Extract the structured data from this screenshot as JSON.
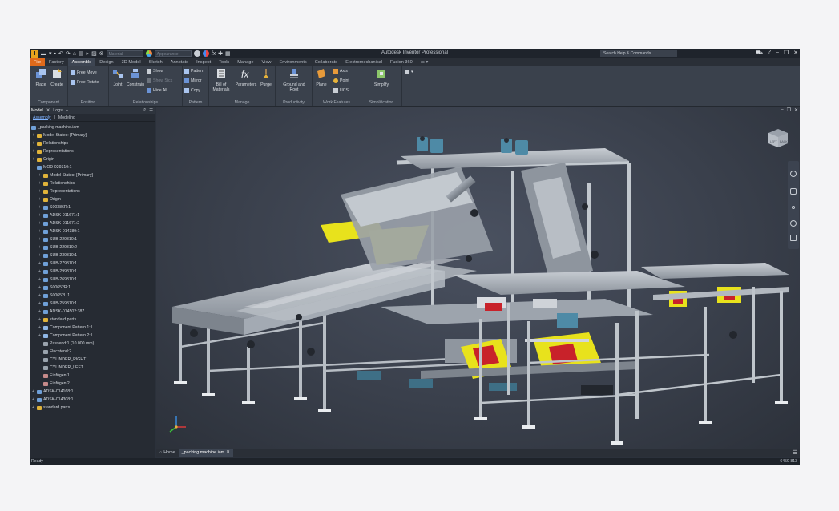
{
  "app_title": "Autodesk Inventor Professional",
  "qat": {
    "material": "Material",
    "appearance": "Appearance"
  },
  "search_placeholder": "Search Help & Commands...",
  "tabs": [
    "File",
    "Factory",
    "Assemble",
    "Design",
    "3D Model",
    "Sketch",
    "Annotate",
    "Inspect",
    "Tools",
    "Manage",
    "View",
    "Environments",
    "Collaborate",
    "Electromechanical",
    "Fusion 360"
  ],
  "active_tab": "Assemble",
  "ribbon": {
    "place": "Place",
    "create": "Create",
    "free_move": "Free Move",
    "free_rotate": "Free Rotate",
    "joint": "Joint",
    "constrain": "Constrain",
    "show": "Show",
    "show_sick": "Show Sick",
    "hide_all": "Hide All",
    "pattern": "Pattern",
    "mirror": "Mirror",
    "copy": "Copy",
    "bom_1": "Bill of",
    "bom_2": "Materials",
    "parameters": "Parameters",
    "purge": "Purge",
    "ground_1": "Ground and",
    "ground_2": "Root",
    "plane": "Plane",
    "axis": "Axis",
    "point": "Point",
    "ucs": "UCS",
    "simplify": "Simplify",
    "panel_component": "Component",
    "panel_position": "Position",
    "panel_relationships": "Relationships",
    "panel_pattern": "Pattern",
    "panel_manage": "Manage",
    "panel_productivity": "Productivity",
    "panel_workfeatures": "Work Features",
    "panel_simplification": "Simplification"
  },
  "browser": {
    "tab_model": "Model",
    "tab_logs": "Logs",
    "sub_assembly": "Assembly",
    "sub_modeling": "Modeling",
    "root": "_packing machine.iam",
    "nodes": [
      {
        "label": "Model States: [Primary]",
        "indent": 1,
        "exp": "+",
        "color": "#e0b33a"
      },
      {
        "label": "Relationships",
        "indent": 1,
        "exp": "+",
        "color": "#e0b33a"
      },
      {
        "label": "Representations",
        "indent": 1,
        "exp": "+",
        "color": "#e0b33a"
      },
      {
        "label": "Origin",
        "indent": 1,
        "exp": "+",
        "color": "#e0b33a"
      },
      {
        "label": "MOD-029310:1",
        "indent": 1,
        "exp": "−",
        "color": "#6fa0d8"
      },
      {
        "label": "Model States: [Primary]",
        "indent": 2,
        "exp": "+",
        "color": "#e0b33a"
      },
      {
        "label": "Relationships",
        "indent": 2,
        "exp": "+",
        "color": "#e0b33a"
      },
      {
        "label": "Representations",
        "indent": 2,
        "exp": "+",
        "color": "#e0b33a"
      },
      {
        "label": "Origin",
        "indent": 2,
        "exp": "+",
        "color": "#e0b33a"
      },
      {
        "label": "S00386R:1",
        "indent": 2,
        "exp": "+",
        "color": "#6fa0d8"
      },
      {
        "label": "ADSK-011671:1",
        "indent": 2,
        "exp": "+",
        "color": "#6fa0d8"
      },
      {
        "label": "ADSK-011671:2",
        "indent": 2,
        "exp": "+",
        "color": "#6fa0d8"
      },
      {
        "label": "ADSK-014389:1",
        "indent": 2,
        "exp": "+",
        "color": "#6fa0d8"
      },
      {
        "label": "SUB-229310:1",
        "indent": 2,
        "exp": "+",
        "color": "#6fa0d8"
      },
      {
        "label": "SUB-229310:2",
        "indent": 2,
        "exp": "+",
        "color": "#6fa0d8"
      },
      {
        "label": "SUB-239310:1",
        "indent": 2,
        "exp": "+",
        "color": "#6fa0d8"
      },
      {
        "label": "SUB-279310:1",
        "indent": 2,
        "exp": "+",
        "color": "#6fa0d8"
      },
      {
        "label": "SUB-299310:1",
        "indent": 2,
        "exp": "+",
        "color": "#6fa0d8"
      },
      {
        "label": "SUB-269310:1",
        "indent": 2,
        "exp": "+",
        "color": "#6fa0d8"
      },
      {
        "label": "S00652R:1",
        "indent": 2,
        "exp": "+",
        "color": "#6fa0d8"
      },
      {
        "label": "S00652L:1",
        "indent": 2,
        "exp": "+",
        "color": "#6fa0d8"
      },
      {
        "label": "SUB-259310:1",
        "indent": 2,
        "exp": "+",
        "color": "#6fa0d8"
      },
      {
        "label": "ADSK-014502:387",
        "indent": 2,
        "exp": "+",
        "color": "#6fa0d8"
      },
      {
        "label": "standard parts",
        "indent": 2,
        "exp": "+",
        "color": "#e0b33a"
      },
      {
        "label": "Component Pattern 1:1",
        "indent": 2,
        "exp": "+",
        "color": "#8fb7e6"
      },
      {
        "label": "Component Pattern 2:1",
        "indent": 2,
        "exp": "+",
        "color": "#8fb7e6"
      },
      {
        "label": "Passend:1 (10.000 mm)",
        "indent": 2,
        "exp": "",
        "color": "#9aa3ad"
      },
      {
        "label": "Fluchtend:2",
        "indent": 2,
        "exp": "",
        "color": "#9aa3ad"
      },
      {
        "label": "CYLINDER_RIGHT",
        "indent": 2,
        "exp": "",
        "color": "#9aa3ad"
      },
      {
        "label": "CYLINDER_LEFT",
        "indent": 2,
        "exp": "",
        "color": "#9aa3ad"
      },
      {
        "label": "Einfügen:1",
        "indent": 2,
        "exp": "",
        "color": "#c58a8a"
      },
      {
        "label": "Einfügen:2",
        "indent": 2,
        "exp": "",
        "color": "#c58a8a"
      },
      {
        "label": "ADSK-014168:1",
        "indent": 1,
        "exp": "+",
        "color": "#6fa0d8"
      },
      {
        "label": "ADSK-014308:1",
        "indent": 1,
        "exp": "+",
        "color": "#6fa0d8"
      },
      {
        "label": "standard parts",
        "indent": 1,
        "exp": "+",
        "color": "#e0b33a"
      }
    ]
  },
  "doc_tabs": {
    "home": "Home",
    "doc": "_packing machine.iam"
  },
  "viewcube": {
    "left": "LEFT",
    "back": "BACK"
  },
  "status": {
    "left": "Ready",
    "right": "6459   813"
  }
}
